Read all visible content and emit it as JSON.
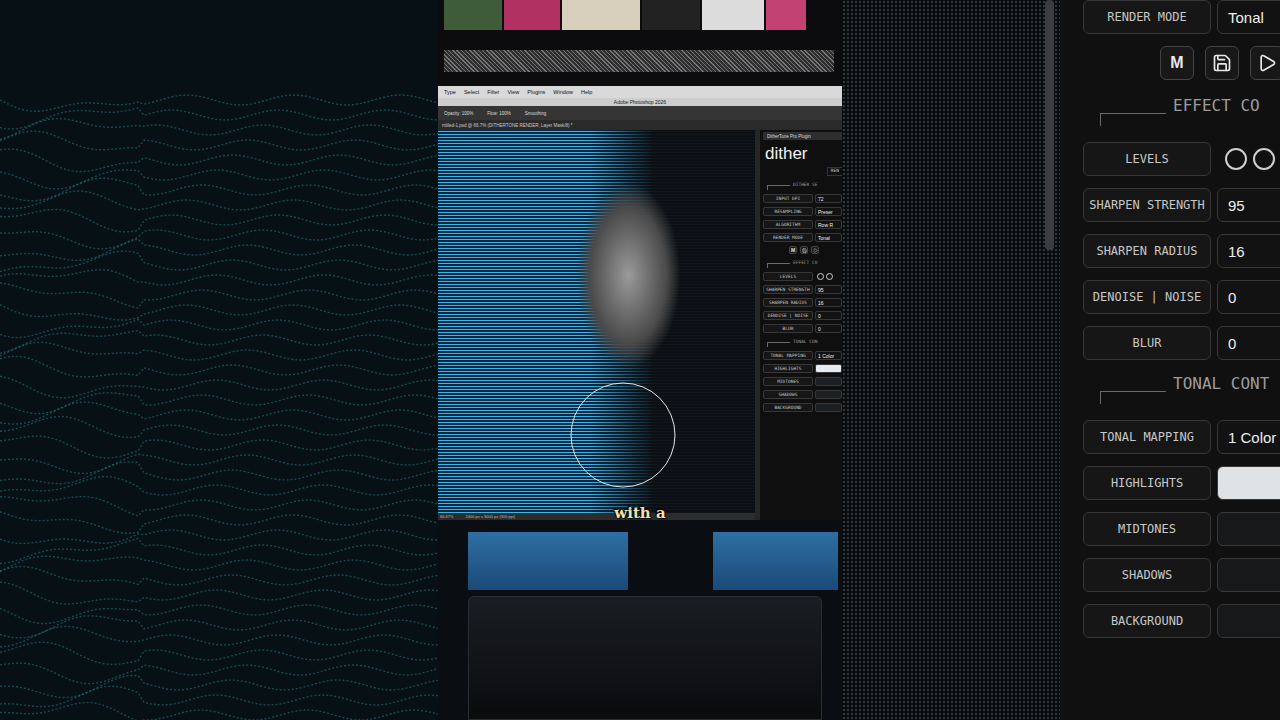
{
  "photoshop": {
    "menu": [
      "Type",
      "Select",
      "Filter",
      "View",
      "Plugins",
      "Window",
      "Help"
    ],
    "title": "Adobe Photoshop 2026",
    "options": [
      "Opacity: 100%",
      "Flow: 100%",
      "Smoothing"
    ],
    "document_tab": "ntitled-1.psd @ 66.7% (DITHERTONE RENDER, Layer Mask/8) *",
    "status": [
      "66.67%",
      "2400 px x 3000 px (300 ppi)"
    ],
    "plugin": {
      "tab": "DitherTone Pro Plugin",
      "logo": "dither",
      "subtitle": "REN",
      "rows": [
        {
          "kind": "header",
          "label": "DITHER SE"
        },
        {
          "kind": "value",
          "label": "INPUT DPI",
          "value": "72"
        },
        {
          "kind": "value",
          "label": "RESAMPLING",
          "value": "Preser"
        },
        {
          "kind": "value",
          "label": "ALGORITHM",
          "value": "Row R"
        },
        {
          "kind": "value",
          "label": "RENDER MODE",
          "value": "Tonal"
        },
        {
          "kind": "icons",
          "key": "M"
        },
        {
          "kind": "header",
          "label": "EFFECT CO"
        },
        {
          "kind": "toggle",
          "label": "LEVELS"
        },
        {
          "kind": "value",
          "label": "SHARPEN STRENGTH",
          "value": "95"
        },
        {
          "kind": "value",
          "label": "SHARPEN RADIUS",
          "value": "16"
        },
        {
          "kind": "value",
          "label": "DENOISE | NOISE",
          "value": "0"
        },
        {
          "kind": "value",
          "label": "BLUR",
          "value": "0"
        },
        {
          "kind": "header",
          "label": "TONAL CON"
        },
        {
          "kind": "value",
          "label": "TONAL MAPPING",
          "value": "1 Color"
        },
        {
          "kind": "swatch",
          "label": "HIGHLIGHTS",
          "color": "#e6ecef"
        },
        {
          "kind": "swatch",
          "label": "MIDTONES",
          "color": "#1c1f21"
        },
        {
          "kind": "swatch",
          "label": "SHADOWS",
          "color": "#1c1f21"
        },
        {
          "kind": "swatch",
          "label": "BACKGROUND",
          "color": "#1c1f21"
        }
      ]
    }
  },
  "zoom_panel": {
    "rows": [
      {
        "kind": "value",
        "label": "RENDER MODE",
        "value": "Tonal"
      },
      {
        "kind": "icons",
        "key": "M"
      },
      {
        "kind": "header",
        "label": "EFFECT CO"
      },
      {
        "kind": "toggle",
        "label": "LEVELS"
      },
      {
        "kind": "value",
        "label": "SHARPEN STRENGTH",
        "value": "95"
      },
      {
        "kind": "value",
        "label": "SHARPEN RADIUS",
        "value": "16"
      },
      {
        "kind": "value",
        "label": "DENOISE | NOISE",
        "value": "0"
      },
      {
        "kind": "value",
        "label": "BLUR",
        "value": "0"
      },
      {
        "kind": "header",
        "label": "TONAL CONT"
      },
      {
        "kind": "value",
        "label": "TONAL MAPPING",
        "value": "1 Color"
      },
      {
        "kind": "swatch",
        "label": "HIGHLIGHTS",
        "color": "#dfe3e5"
      },
      {
        "kind": "swatch",
        "label": "MIDTONES",
        "color": "#161819"
      },
      {
        "kind": "swatch",
        "label": "SHADOWS",
        "color": "#161819"
      },
      {
        "kind": "swatch",
        "label": "BACKGROUND",
        "color": "#161819"
      }
    ]
  },
  "caption": "with a"
}
